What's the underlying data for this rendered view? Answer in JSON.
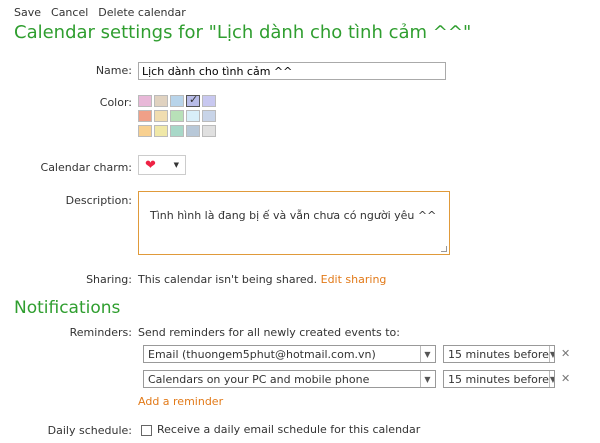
{
  "toolbar": {
    "save": "Save",
    "cancel": "Cancel",
    "delete": "Delete calendar"
  },
  "page_title": "Calendar settings for \"Lịch dành cho tình cảm ^^\"",
  "name": {
    "label": "Name:",
    "value": "Lịch dành cho tình cảm ^^"
  },
  "color": {
    "label": "Color:",
    "swatches": [
      "#e8b8d8",
      "#e0d2c0",
      "#b8d4ea",
      "#b8bce8",
      "#c8c8f0",
      "#f0a088",
      "#f0ddb0",
      "#b8e0b8",
      "#d8eef8",
      "#c8d4e8",
      "#f8d090",
      "#f0e8a8",
      "#a8d8c8",
      "#b8c8d8",
      "#e0e0e0"
    ],
    "selected_index": 3
  },
  "charm": {
    "label": "Calendar charm:",
    "icon": "heart-icon"
  },
  "description": {
    "label": "Description:",
    "value": "Tình hình là đang bị ế và vẫn chưa có người yêu ^^"
  },
  "sharing": {
    "label": "Sharing:",
    "text": "This calendar isn't being shared.",
    "link": "Edit sharing"
  },
  "notifications": {
    "title": "Notifications",
    "reminders_label": "Reminders:",
    "reminders_text": "Send reminders for all newly created events to:",
    "rows": [
      {
        "target": "Email (thuongem5phut@hotmail.com.vn)",
        "time": "15 minutes before"
      },
      {
        "target": "Calendars on your PC and mobile phone",
        "time": "15 minutes before"
      }
    ],
    "add_reminder": "Add a reminder",
    "daily_label": "Daily schedule:",
    "daily_text": "Receive a daily email schedule for this calendar"
  },
  "colors": {
    "accent_green": "#2f9e2f",
    "link_orange": "#e27a19",
    "focus_border": "#e09a3a"
  }
}
